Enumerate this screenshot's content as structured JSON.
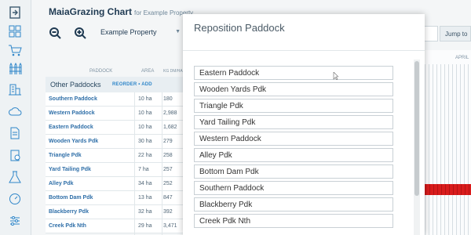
{
  "app": {
    "title": "MaiaGrazing Chart",
    "subtitle": "for Example Property"
  },
  "toolbar": {
    "property_select": "Example Property",
    "jump_label": "Jump to"
  },
  "table": {
    "header_paddock": "PADDOCK",
    "header_area": "AREA",
    "header_kg": "KG DM/HA",
    "section_title": "Other Paddocks",
    "section_actions": "REORDER • ADD",
    "rows": [
      {
        "name": "Southern Paddock",
        "area": "10 ha",
        "kg": "180"
      },
      {
        "name": "Western Paddock",
        "area": "10 ha",
        "kg": "2,988"
      },
      {
        "name": "Eastern Paddock",
        "area": "10 ha",
        "kg": "1,682"
      },
      {
        "name": "Wooden Yards Pdk",
        "area": "30 ha",
        "kg": "279"
      },
      {
        "name": "Triangle Pdk",
        "area": "22 ha",
        "kg": "258"
      },
      {
        "name": "Yard Tailing Pdk",
        "area": "7 ha",
        "kg": "257"
      },
      {
        "name": "Alley Pdk",
        "area": "34 ha",
        "kg": "252"
      },
      {
        "name": "Bottom Dam Pdk",
        "area": "13 ha",
        "kg": "847"
      },
      {
        "name": "Blackberry Pdk",
        "area": "32 ha",
        "kg": "392"
      },
      {
        "name": "Creek Pdk Nth",
        "area": "29 ha",
        "kg": "3,471"
      }
    ]
  },
  "timeline": {
    "month": "APRIL",
    "bar_color": "#d91c1c"
  },
  "modal": {
    "title": "Reposition Paddock",
    "items": [
      "Eastern Paddock",
      "Wooden Yards Pdk",
      "Triangle Pdk",
      "Yard Tailing Pdk",
      "Western Paddock",
      "Alley Pdk",
      "Bottom Dam Pdk",
      "Southern Paddock",
      "Blackberry Pdk",
      "Creek Pdk Nth"
    ]
  },
  "icons": {
    "rail": [
      "logout-icon",
      "grid-icon",
      "cart-icon",
      "fence-icon",
      "building-icon",
      "cloud-icon",
      "document-icon",
      "location-icon",
      "flask-icon",
      "gauge-icon",
      "settings-icon"
    ]
  },
  "colors": {
    "link": "#2f6fa8",
    "accent": "#2f86c9",
    "title": "#1f3a52"
  }
}
